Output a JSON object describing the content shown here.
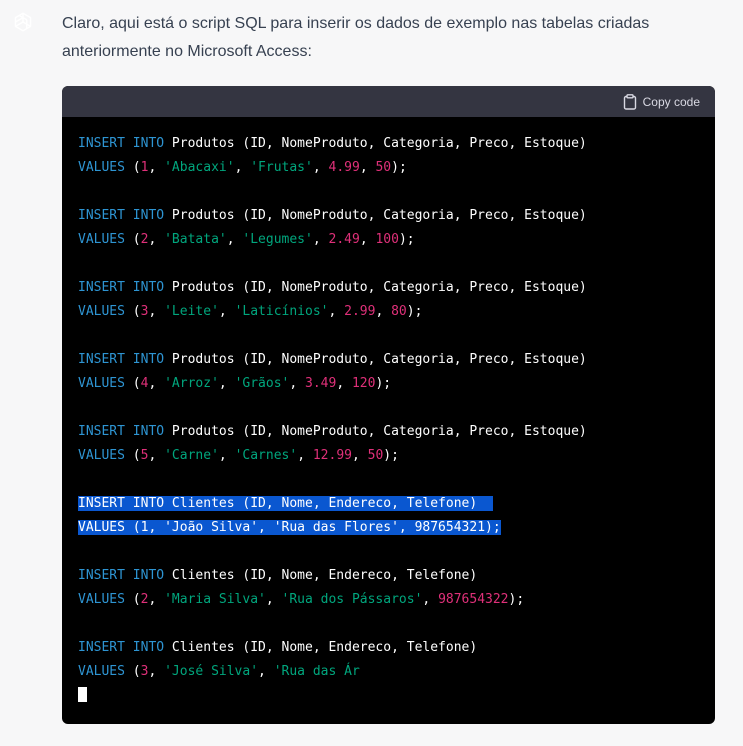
{
  "message": {
    "avatar_icon": "openai-logo-icon",
    "avatar_color": "#10a37f",
    "intro_text": "Claro, aqui está o script SQL para inserir os dados de exemplo nas tabelas criadas anteriormente no Microsoft Access:"
  },
  "code_block": {
    "copy_label": "Copy code",
    "copy_icon": "clipboard-icon",
    "colors": {
      "keyword": "#2e95d3",
      "string": "#00a67d",
      "number": "#df3079",
      "selection": "#0a57d0"
    },
    "statements": [
      {
        "insert": [
          "INSERT",
          " ",
          "INTO",
          " Produtos (ID, NomeProduto, Categoria, Preco, Estoque)"
        ],
        "values": {
          "kw": "VALUES",
          "open": " (",
          "parts": [
            [
              "num",
              "1"
            ],
            [
              "p",
              ", "
            ],
            [
              "str",
              "'Abacaxi'"
            ],
            [
              "p",
              ", "
            ],
            [
              "str",
              "'Frutas'"
            ],
            [
              "p",
              ", "
            ],
            [
              "num",
              "4.99"
            ],
            [
              "p",
              ", "
            ],
            [
              "num",
              "50"
            ]
          ],
          "close": ");"
        }
      },
      {
        "insert": [
          "INSERT",
          " ",
          "INTO",
          " Produtos (ID, NomeProduto, Categoria, Preco, Estoque)"
        ],
        "values": {
          "kw": "VALUES",
          "open": " (",
          "parts": [
            [
              "num",
              "2"
            ],
            [
              "p",
              ", "
            ],
            [
              "str",
              "'Batata'"
            ],
            [
              "p",
              ", "
            ],
            [
              "str",
              "'Legumes'"
            ],
            [
              "p",
              ", "
            ],
            [
              "num",
              "2.49"
            ],
            [
              "p",
              ", "
            ],
            [
              "num",
              "100"
            ]
          ],
          "close": ");"
        }
      },
      {
        "insert": [
          "INSERT",
          " ",
          "INTO",
          " Produtos (ID, NomeProduto, Categoria, Preco, Estoque)"
        ],
        "values": {
          "kw": "VALUES",
          "open": " (",
          "parts": [
            [
              "num",
              "3"
            ],
            [
              "p",
              ", "
            ],
            [
              "str",
              "'Leite'"
            ],
            [
              "p",
              ", "
            ],
            [
              "str",
              "'Laticínios'"
            ],
            [
              "p",
              ", "
            ],
            [
              "num",
              "2.99"
            ],
            [
              "p",
              ", "
            ],
            [
              "num",
              "80"
            ]
          ],
          "close": ");"
        }
      },
      {
        "insert": [
          "INSERT",
          " ",
          "INTO",
          " Produtos (ID, NomeProduto, Categoria, Preco, Estoque)"
        ],
        "values": {
          "kw": "VALUES",
          "open": " (",
          "parts": [
            [
              "num",
              "4"
            ],
            [
              "p",
              ", "
            ],
            [
              "str",
              "'Arroz'"
            ],
            [
              "p",
              ", "
            ],
            [
              "str",
              "'Grãos'"
            ],
            [
              "p",
              ", "
            ],
            [
              "num",
              "3.49"
            ],
            [
              "p",
              ", "
            ],
            [
              "num",
              "120"
            ]
          ],
          "close": ");"
        }
      },
      {
        "insert": [
          "INSERT",
          " ",
          "INTO",
          " Produtos (ID, NomeProduto, Categoria, Preco, Estoque)"
        ],
        "values": {
          "kw": "VALUES",
          "open": " (",
          "parts": [
            [
              "num",
              "5"
            ],
            [
              "p",
              ", "
            ],
            [
              "str",
              "'Carne'"
            ],
            [
              "p",
              ", "
            ],
            [
              "str",
              "'Carnes'"
            ],
            [
              "p",
              ", "
            ],
            [
              "num",
              "12.99"
            ],
            [
              "p",
              ", "
            ],
            [
              "num",
              "50"
            ]
          ],
          "close": ");"
        }
      },
      {
        "selected": true,
        "insert": [
          "INSERT",
          " ",
          "INTO",
          " Clientes (ID, Nome, Endereco, Telefone)  "
        ],
        "values": {
          "kw": "VALUES",
          "open": " (",
          "parts": [
            [
              "num",
              "1"
            ],
            [
              "p",
              ", "
            ],
            [
              "str",
              "'João Silva'"
            ],
            [
              "p",
              ", "
            ],
            [
              "str",
              "'Rua das Flores'"
            ],
            [
              "p",
              ", "
            ],
            [
              "num",
              "987654321"
            ]
          ],
          "close": ");"
        }
      },
      {
        "insert": [
          "INSERT",
          " ",
          "INTO",
          " Clientes (ID, Nome, Endereco, Telefone)"
        ],
        "values": {
          "kw": "VALUES",
          "open": " (",
          "parts": [
            [
              "num",
              "2"
            ],
            [
              "p",
              ", "
            ],
            [
              "str",
              "'Maria Silva'"
            ],
            [
              "p",
              ", "
            ],
            [
              "str",
              "'Rua dos Pássaros'"
            ],
            [
              "p",
              ", "
            ],
            [
              "num",
              "987654322"
            ]
          ],
          "close": ");"
        }
      },
      {
        "insert": [
          "INSERT",
          " ",
          "INTO",
          " Clientes (ID, Nome, Endereco, Telefone)"
        ],
        "values": {
          "kw": "VALUES",
          "open": " (",
          "parts": [
            [
              "num",
              "3"
            ],
            [
              "p",
              ", "
            ],
            [
              "str",
              "'José Silva'"
            ],
            [
              "p",
              ", "
            ],
            [
              "str",
              "'Rua das Ár"
            ]
          ],
          "close": ""
        }
      }
    ]
  }
}
